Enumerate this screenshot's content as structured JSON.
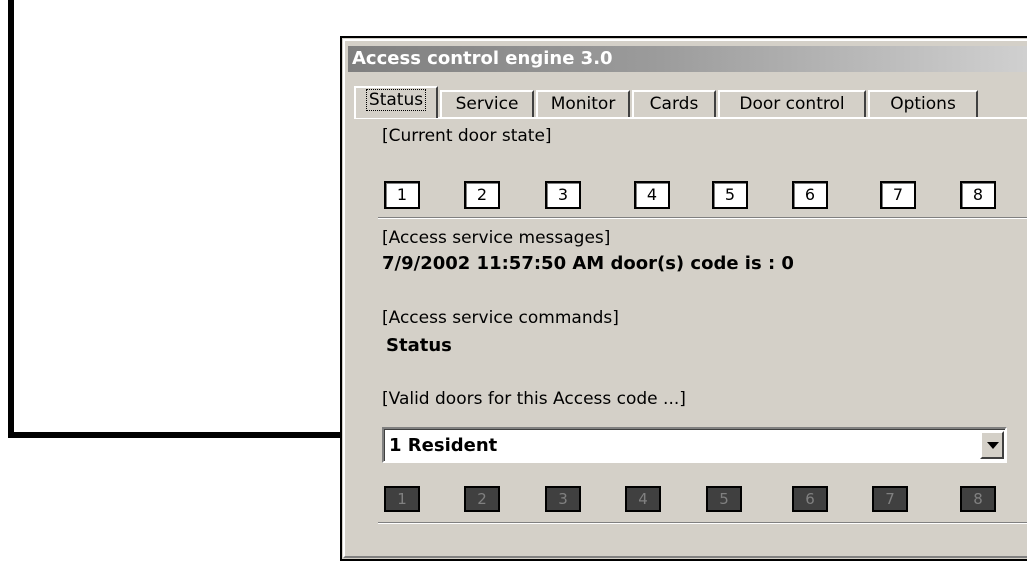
{
  "window": {
    "title": "Access control engine 3.0"
  },
  "tabs": [
    {
      "label": "Status",
      "active": true
    },
    {
      "label": "Service"
    },
    {
      "label": "Monitor"
    },
    {
      "label": "Cards"
    },
    {
      "label": "Door control"
    },
    {
      "label": "Options"
    }
  ],
  "status": {
    "door_state_label": "[Current door state]",
    "door_state": [
      "1",
      "2",
      "3",
      "4",
      "5",
      "6",
      "7",
      "8"
    ],
    "messages_label": "[Access  service messages]",
    "message": "7/9/2002 11:57:50 AM door(s) code is : 0",
    "commands_label": "[Access  service  commands]",
    "command": "Status",
    "valid_doors_label": "[Valid doors for this Access code ...]",
    "access_code_selected": "1 Resident",
    "valid_doors": [
      "1",
      "2",
      "3",
      "4",
      "5",
      "6",
      "7",
      "8"
    ]
  },
  "colors": {
    "window_bg": "#d4d0c8",
    "valid_door_bg": "#404040",
    "title_gradient_start": "#7f7f7f"
  },
  "icons": {
    "dropdown": "chevron-down-icon",
    "annotation": "arrow-icon"
  }
}
